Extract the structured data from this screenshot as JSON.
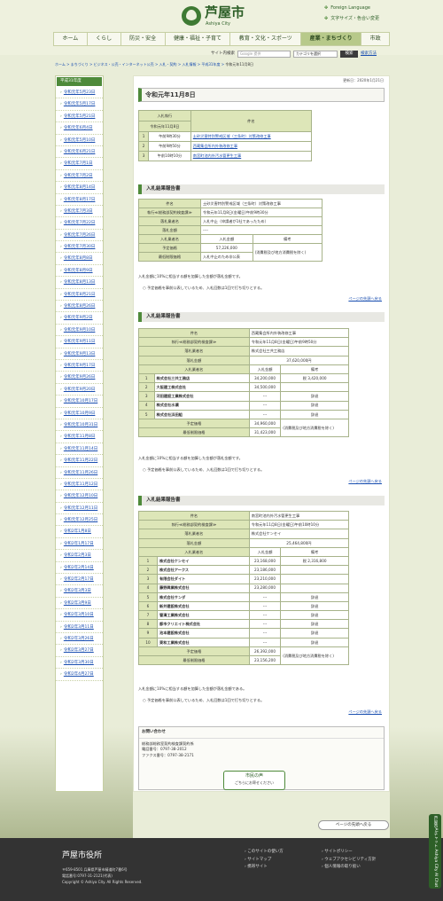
{
  "header": {
    "site_name": "芦屋市",
    "site_sub": "Ashiya City",
    "foreign": "Foreign Language",
    "font": "文字サイズ・色合い変更"
  },
  "gnav": [
    "ホーム",
    "くらし",
    "防災・安全",
    "健康・福祉・子育て",
    "教育・文化・スポーツ",
    "産業・まちづくり",
    "市政"
  ],
  "search": {
    "label": "サイト内検索",
    "placeholder": "Google 提供",
    "category": "カテゴリを選択",
    "button": "検索",
    "howto": "検索方法"
  },
  "breadcrumb": "ホーム > まちづくり > ビジネス・公売・インターネット公売 > 入札・契約 > 入札情報 > 平成31年度 >",
  "breadcrumb_current": "令和元年11月8日",
  "sidebar": {
    "title": "平成31年度",
    "items": [
      "令和元年5月23日",
      "令和元年5月17日",
      "令和元年5月21日",
      "令和元年6月4日",
      "令和元年5月10日",
      "令和元年6月21日",
      "令和元年7月1日",
      "令和元年7月2日",
      "令和元年8月14日",
      "令和元年8月17日",
      "令和元年7月3日",
      "令和元年7月22日",
      "令和元年7月26日",
      "令和元年7月30日",
      "令和元年8月8日",
      "令和元年8月9日",
      "令和元年8月13日",
      "令和元年8月21日",
      "令和元年8月26日",
      "令和元年9月2日",
      "令和元年9月10日",
      "令和元年9月11日",
      "令和元年9月13日",
      "令和元年9月17日",
      "令和元年9月26日",
      "令和元年9月20日",
      "令和元年10月17日",
      "令和元年10月9日",
      "令和元年10月31日",
      "令和元年11月8日",
      "令和元年11月14日",
      "令和元年11月22日",
      "令和元年11月26日",
      "令和元年11月12日",
      "令和元年12月10日",
      "令和元年12月11日",
      "令和元年12月25日",
      "令和2年1月8日",
      "令和2年1月17日",
      "令和2年2月3日",
      "令和2年2月14日",
      "令和2年2月17日",
      "令和2年3月3日",
      "令和2年3月9日",
      "令和2年3月10日",
      "令和2年3月11日",
      "令和2年3月26日",
      "令和2年3月27日",
      "令和2年3月30日",
      "令和2年4月27日"
    ]
  },
  "main": {
    "updated": "更新日：2020年1月21日",
    "title": "令和元年11月8日",
    "schedule": {
      "h1": "入札執行",
      "h2": "令和元年11月8日",
      "h3": "件名",
      "rows": [
        [
          "1",
          "午前9時30分",
          "土砂災害特別警戒区域（三条町）対策改修工事"
        ],
        [
          "2",
          "午前9時50分",
          "西蔵集会所内外装改修工事"
        ],
        [
          "3",
          "午前10時10分",
          "南宮町池内外汚水管更生工事"
        ]
      ]
    },
    "report_title": "入札結果報告書",
    "r1": {
      "subject": "土砂災害特別警戒区域（三条町）対策改修工事",
      "time": "令和元年11月8日(金曜日)午前9時30分",
      "winner": "入札中止（申請者が1社であったため）",
      "price": "----",
      "h_name": "入札業者名",
      "h_price": "入札金額",
      "h_note": "備考",
      "planned": "57,226,000",
      "minimum": "入札中止のため非公表",
      "tax": "(消費税及び地方消費税を除く)"
    },
    "r2": {
      "subject": "西蔵集会所内外装改修工事",
      "time": "令和元年11月8日(金曜日)午前9時50分",
      "winner": "株式会社三共工務店",
      "price": "37,620,000円",
      "rows": [
        [
          "1",
          "株式会社三共工務店",
          "34,200,000",
          "税 3,420,000"
        ],
        [
          "2",
          "大阪建工株式会社",
          "34,500,000",
          ""
        ],
        [
          "3",
          "河田建設工業株式会社",
          "---",
          "辞退"
        ],
        [
          "4",
          "株式会社水瀬",
          "---",
          "辞退"
        ],
        [
          "5",
          "株式会社浜田組",
          "---",
          "辞退"
        ]
      ],
      "planned": "34,960,000",
      "minimum": "31,423,000",
      "tax": "(消費税及び地方消費税を除く)"
    },
    "r3": {
      "subject": "南宮町池内外汚水管更生工事",
      "time": "令和元年11月8日(金曜日)午前10時10分",
      "winner": "株式会社ケンセイ",
      "price": "25,464,800円",
      "rows": [
        [
          "1",
          "株式会社ケンセイ",
          "23,168,000",
          "税 2,316,800"
        ],
        [
          "2",
          "株式会社アークス",
          "23,186,000",
          ""
        ],
        [
          "3",
          "有限会社ダイト",
          "23,210,000",
          ""
        ],
        [
          "4",
          "藤野興業株式会社",
          "23,280,000",
          ""
        ],
        [
          "5",
          "株式会社サンダ",
          "---",
          "辞退"
        ],
        [
          "6",
          "新井建設株式会社",
          "---",
          "辞退"
        ],
        [
          "7",
          "管清工業株式会社",
          "---",
          "辞退"
        ],
        [
          "8",
          "都市クリエイト株式会社",
          "---",
          "辞退"
        ],
        [
          "9",
          "池本建設株式会社",
          "---",
          "辞退"
        ],
        [
          "10",
          "東和工業株式会社",
          "---",
          "辞退"
        ]
      ],
      "planned": "26,392,000",
      "minimum": "23,156,200",
      "tax": "(消費税及び地方消費税を除く)"
    },
    "labels": {
      "subject": "件名",
      "time": "執行≪総務部契約検査課≫",
      "winner": "落札業者名",
      "price": "落札金額",
      "bidder": "入札業者名",
      "planned": "予定価格",
      "minimum": "最低制限価格"
    },
    "note1": "入札金額に10%に相当する額を加算した金額が落札金額です。",
    "note2": "○ 予定価格を事前公表しているため、入札回数は1回で打ち切りとする。",
    "note1b": "入札金額に10%に相当する額を加算した金額が落札金額である。",
    "back_top": "ページの先頭へ戻る",
    "inquiry": {
      "title": "お問い合わせ",
      "dept": "総務部総務室契約検査課契約係",
      "tel": "電話番号：0797-38-2012",
      "fax": "ファクス番号：0797-38-2171"
    },
    "voice": {
      "title": "市民の声",
      "sub": "ごちらにお寄せください"
    }
  },
  "page_top": "ページの先頭へ戻る",
  "footer": {
    "name": "芦屋市役所",
    "addr": "〒659-8501 兵庫県芦屋市精道町7番6号",
    "tel": "電話番号:0797-31-2121(代表)",
    "copy": "Copyright © Ashiya City. All Rights Reserved.",
    "links1": [
      "このサイトの使い方",
      "サイトマップ",
      "携帯サイト"
    ],
    "links2": [
      "サイトポリシー",
      "ウェブアクセシビリティ方針",
      "個人情報の取り扱い"
    ]
  },
  "ai_chat": "芦屋市AIチャット Ashiya City AI Chat"
}
